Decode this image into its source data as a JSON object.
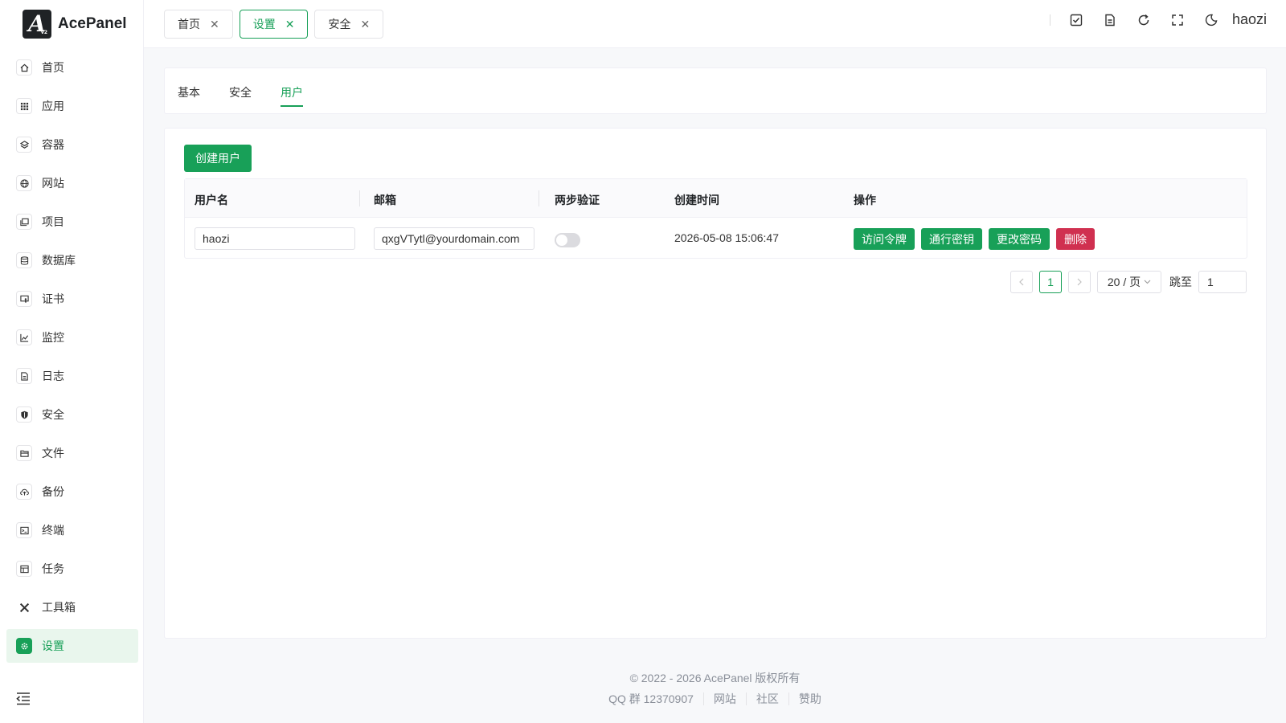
{
  "app": {
    "name": "AcePanel"
  },
  "sidebar": {
    "items": [
      {
        "label": "首页",
        "icon": "home-icon"
      },
      {
        "label": "应用",
        "icon": "apps-icon"
      },
      {
        "label": "容器",
        "icon": "container-icon"
      },
      {
        "label": "网站",
        "icon": "globe-icon"
      },
      {
        "label": "项目",
        "icon": "project-icon"
      },
      {
        "label": "数据库",
        "icon": "database-icon"
      },
      {
        "label": "证书",
        "icon": "certificate-icon"
      },
      {
        "label": "监控",
        "icon": "chart-icon"
      },
      {
        "label": "日志",
        "icon": "log-icon"
      },
      {
        "label": "安全",
        "icon": "shield-icon"
      },
      {
        "label": "文件",
        "icon": "folder-icon"
      },
      {
        "label": "备份",
        "icon": "cloud-backup-icon"
      },
      {
        "label": "终端",
        "icon": "terminal-icon"
      },
      {
        "label": "任务",
        "icon": "task-icon"
      },
      {
        "label": "工具箱",
        "icon": "tools-icon"
      },
      {
        "label": "设置",
        "icon": "gear-icon",
        "active": true
      }
    ]
  },
  "header": {
    "tabs": [
      {
        "label": "首页"
      },
      {
        "label": "设置",
        "active": true
      },
      {
        "label": "安全"
      }
    ],
    "username": "haozi"
  },
  "subtabs": [
    {
      "label": "基本"
    },
    {
      "label": "安全"
    },
    {
      "label": "用户",
      "active": true
    }
  ],
  "main": {
    "create_button": "创建用户",
    "table": {
      "columns": [
        "用户名",
        "邮箱",
        "两步验证",
        "创建时间",
        "操作"
      ],
      "rows": [
        {
          "username": "haozi",
          "email": "qxgVTytl@yourdomain.com",
          "two_factor": false,
          "created_at": "2026-05-08 15:06:47",
          "actions": [
            "访问令牌",
            "通行密钥",
            "更改密码",
            "删除"
          ]
        }
      ]
    },
    "pagination": {
      "current_page": "1",
      "page_size": "20 / 页",
      "jump_label": "跳至",
      "jump_value": "1"
    }
  },
  "footer": {
    "copyright": "© 2022 - 2026 AcePanel 版权所有",
    "links": [
      "QQ 群 12370907",
      "网站",
      "社区",
      "赞助"
    ]
  },
  "colors": {
    "accent": "#18a058",
    "danger": "#d03050"
  }
}
